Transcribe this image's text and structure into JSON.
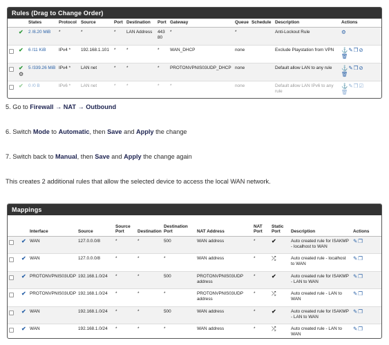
{
  "rules": {
    "title": "Rules (Drag to Change Order)",
    "headers": [
      "",
      "",
      "States",
      "Protocol",
      "Source",
      "Port",
      "Destination",
      "Port",
      "Gateway",
      "Queue",
      "Schedule",
      "Description",
      "Actions"
    ],
    "rows": [
      {
        "states": "2 /8.20 MiB",
        "protocol": "*",
        "source": "*",
        "port": "*",
        "destination": "LAN Address",
        "dport": "443 80",
        "gateway": "*",
        "queue": "*",
        "schedule": "",
        "description": "Anti-Lockout Rule"
      },
      {
        "states": "6 /11 KiB",
        "protocol": "IPv4 *",
        "source": "192.168.1.101",
        "port": "*",
        "destination": "*",
        "dport": "*",
        "gateway": "WAN_DHCP",
        "queue": "none",
        "schedule": "",
        "description": "Exclude Playstation from VPN"
      },
      {
        "states": "5 /339.26 MiB",
        "protocol": "IPv4 *",
        "source": "LAN net",
        "port": "*",
        "destination": "*",
        "dport": "*",
        "gateway": "PROTONVPNIS03UDP_DHCP",
        "queue": "none",
        "schedule": "",
        "description": "Default allow LAN to any rule"
      },
      {
        "states": "0 /0 B",
        "protocol": "IPv6 *",
        "source": "LAN net",
        "port": "*",
        "destination": "*",
        "dport": "*",
        "gateway": "*",
        "queue": "none",
        "schedule": "",
        "description": "Default allow LAN IPv6 to any rule"
      }
    ]
  },
  "steps": {
    "s5_pre": "5. Go to ",
    "s5_b": "Firewall → NAT → Outbound",
    "s6_pre": "6. Switch ",
    "s6_b1": "Mode",
    "s6_m1": " to ",
    "s6_b2": "Automatic",
    "s6_m2": ", then ",
    "s6_b3": "Save",
    "s6_m3": " and ",
    "s6_b4": "Apply",
    "s6_post": " the change",
    "s7_pre": "7. Switch back to ",
    "s7_b1": "Manual",
    "s7_m1": ", then ",
    "s7_b2": "Save",
    "s7_m2": " and ",
    "s7_b3": "Apply",
    "s7_post": " the change again",
    "note": "This creates 2 additional rules that allow the selected device to access the local WAN network."
  },
  "mappings": {
    "title": "Mappings",
    "headers": {
      "interface": "Interface",
      "source": "Source",
      "sport": "Source Port",
      "destination": "Destination",
      "dport": "Destination Port",
      "nat_address": "NAT Address",
      "nat_port": "NAT Port",
      "static_port": "Static Port",
      "description": "Description",
      "actions": "Actions"
    },
    "rows": [
      {
        "interface": "WAN",
        "source": "127.0.0.0/8",
        "sport": "*",
        "destination": "*",
        "dport": "500",
        "nat_address": "WAN address",
        "nat_port": "*",
        "static": "check",
        "description": "Auto created rule for ISAKMP - localhost to WAN"
      },
      {
        "interface": "WAN",
        "source": "127.0.0.0/8",
        "sport": "*",
        "destination": "*",
        "dport": "*",
        "nat_address": "WAN address",
        "nat_port": "*",
        "static": "random",
        "description": "Auto created rule - localhost to WAN"
      },
      {
        "interface": "PROTONVPNIS03UDP",
        "source": "192.168.1.0/24",
        "sport": "*",
        "destination": "*",
        "dport": "500",
        "nat_address": "PROTONVPNIS03UDP address",
        "nat_port": "*",
        "static": "check",
        "description": "Auto created rule for ISAKMP - LAN to WAN"
      },
      {
        "interface": "PROTONVPNIS03UDP",
        "source": "192.168.1.0/24",
        "sport": "*",
        "destination": "*",
        "dport": "*",
        "nat_address": "PROTONVPNIS03UDP address",
        "nat_port": "*",
        "static": "random",
        "description": "Auto created rule - LAN to WAN"
      },
      {
        "interface": "WAN",
        "source": "192.168.1.0/24",
        "sport": "*",
        "destination": "*",
        "dport": "500",
        "nat_address": "WAN address",
        "nat_port": "*",
        "static": "check",
        "description": "Auto created rule for ISAKMP - LAN to WAN"
      },
      {
        "interface": "WAN",
        "source": "192.168.1.0/24",
        "sport": "*",
        "destination": "*",
        "dport": "*",
        "nat_address": "WAN address",
        "nat_port": "*",
        "static": "random",
        "description": "Auto created rule - LAN to WAN"
      }
    ]
  },
  "icons": {
    "pass": "✔",
    "gear": "⚙",
    "check": "✔",
    "random": "⤮",
    "actions_rule": "⚓✎❐⊘",
    "actions_rule_dim": "⚓✎❐☑",
    "trash": "🗑",
    "actions_map": "✎❐"
  }
}
